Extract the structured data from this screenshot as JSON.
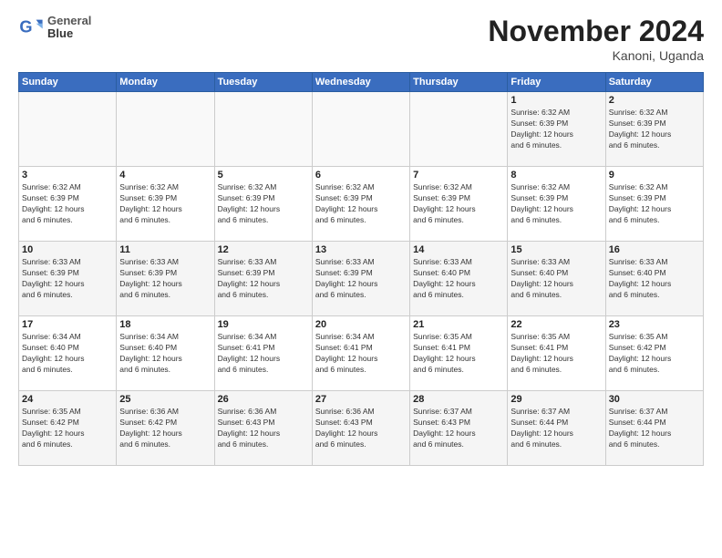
{
  "logo": {
    "line1": "General",
    "line2": "Blue"
  },
  "title": "November 2024",
  "location": "Kanoni, Uganda",
  "days_header": [
    "Sunday",
    "Monday",
    "Tuesday",
    "Wednesday",
    "Thursday",
    "Friday",
    "Saturday"
  ],
  "weeks": [
    [
      {
        "num": "",
        "info": ""
      },
      {
        "num": "",
        "info": ""
      },
      {
        "num": "",
        "info": ""
      },
      {
        "num": "",
        "info": ""
      },
      {
        "num": "",
        "info": ""
      },
      {
        "num": "1",
        "info": "Sunrise: 6:32 AM\nSunset: 6:39 PM\nDaylight: 12 hours\nand 6 minutes."
      },
      {
        "num": "2",
        "info": "Sunrise: 6:32 AM\nSunset: 6:39 PM\nDaylight: 12 hours\nand 6 minutes."
      }
    ],
    [
      {
        "num": "3",
        "info": "Sunrise: 6:32 AM\nSunset: 6:39 PM\nDaylight: 12 hours\nand 6 minutes."
      },
      {
        "num": "4",
        "info": "Sunrise: 6:32 AM\nSunset: 6:39 PM\nDaylight: 12 hours\nand 6 minutes."
      },
      {
        "num": "5",
        "info": "Sunrise: 6:32 AM\nSunset: 6:39 PM\nDaylight: 12 hours\nand 6 minutes."
      },
      {
        "num": "6",
        "info": "Sunrise: 6:32 AM\nSunset: 6:39 PM\nDaylight: 12 hours\nand 6 minutes."
      },
      {
        "num": "7",
        "info": "Sunrise: 6:32 AM\nSunset: 6:39 PM\nDaylight: 12 hours\nand 6 minutes."
      },
      {
        "num": "8",
        "info": "Sunrise: 6:32 AM\nSunset: 6:39 PM\nDaylight: 12 hours\nand 6 minutes."
      },
      {
        "num": "9",
        "info": "Sunrise: 6:32 AM\nSunset: 6:39 PM\nDaylight: 12 hours\nand 6 minutes."
      }
    ],
    [
      {
        "num": "10",
        "info": "Sunrise: 6:33 AM\nSunset: 6:39 PM\nDaylight: 12 hours\nand 6 minutes."
      },
      {
        "num": "11",
        "info": "Sunrise: 6:33 AM\nSunset: 6:39 PM\nDaylight: 12 hours\nand 6 minutes."
      },
      {
        "num": "12",
        "info": "Sunrise: 6:33 AM\nSunset: 6:39 PM\nDaylight: 12 hours\nand 6 minutes."
      },
      {
        "num": "13",
        "info": "Sunrise: 6:33 AM\nSunset: 6:39 PM\nDaylight: 12 hours\nand 6 minutes."
      },
      {
        "num": "14",
        "info": "Sunrise: 6:33 AM\nSunset: 6:40 PM\nDaylight: 12 hours\nand 6 minutes."
      },
      {
        "num": "15",
        "info": "Sunrise: 6:33 AM\nSunset: 6:40 PM\nDaylight: 12 hours\nand 6 minutes."
      },
      {
        "num": "16",
        "info": "Sunrise: 6:33 AM\nSunset: 6:40 PM\nDaylight: 12 hours\nand 6 minutes."
      }
    ],
    [
      {
        "num": "17",
        "info": "Sunrise: 6:34 AM\nSunset: 6:40 PM\nDaylight: 12 hours\nand 6 minutes."
      },
      {
        "num": "18",
        "info": "Sunrise: 6:34 AM\nSunset: 6:40 PM\nDaylight: 12 hours\nand 6 minutes."
      },
      {
        "num": "19",
        "info": "Sunrise: 6:34 AM\nSunset: 6:41 PM\nDaylight: 12 hours\nand 6 minutes."
      },
      {
        "num": "20",
        "info": "Sunrise: 6:34 AM\nSunset: 6:41 PM\nDaylight: 12 hours\nand 6 minutes."
      },
      {
        "num": "21",
        "info": "Sunrise: 6:35 AM\nSunset: 6:41 PM\nDaylight: 12 hours\nand 6 minutes."
      },
      {
        "num": "22",
        "info": "Sunrise: 6:35 AM\nSunset: 6:41 PM\nDaylight: 12 hours\nand 6 minutes."
      },
      {
        "num": "23",
        "info": "Sunrise: 6:35 AM\nSunset: 6:42 PM\nDaylight: 12 hours\nand 6 minutes."
      }
    ],
    [
      {
        "num": "24",
        "info": "Sunrise: 6:35 AM\nSunset: 6:42 PM\nDaylight: 12 hours\nand 6 minutes."
      },
      {
        "num": "25",
        "info": "Sunrise: 6:36 AM\nSunset: 6:42 PM\nDaylight: 12 hours\nand 6 minutes."
      },
      {
        "num": "26",
        "info": "Sunrise: 6:36 AM\nSunset: 6:43 PM\nDaylight: 12 hours\nand 6 minutes."
      },
      {
        "num": "27",
        "info": "Sunrise: 6:36 AM\nSunset: 6:43 PM\nDaylight: 12 hours\nand 6 minutes."
      },
      {
        "num": "28",
        "info": "Sunrise: 6:37 AM\nSunset: 6:43 PM\nDaylight: 12 hours\nand 6 minutes."
      },
      {
        "num": "29",
        "info": "Sunrise: 6:37 AM\nSunset: 6:44 PM\nDaylight: 12 hours\nand 6 minutes."
      },
      {
        "num": "30",
        "info": "Sunrise: 6:37 AM\nSunset: 6:44 PM\nDaylight: 12 hours\nand 6 minutes."
      }
    ]
  ]
}
